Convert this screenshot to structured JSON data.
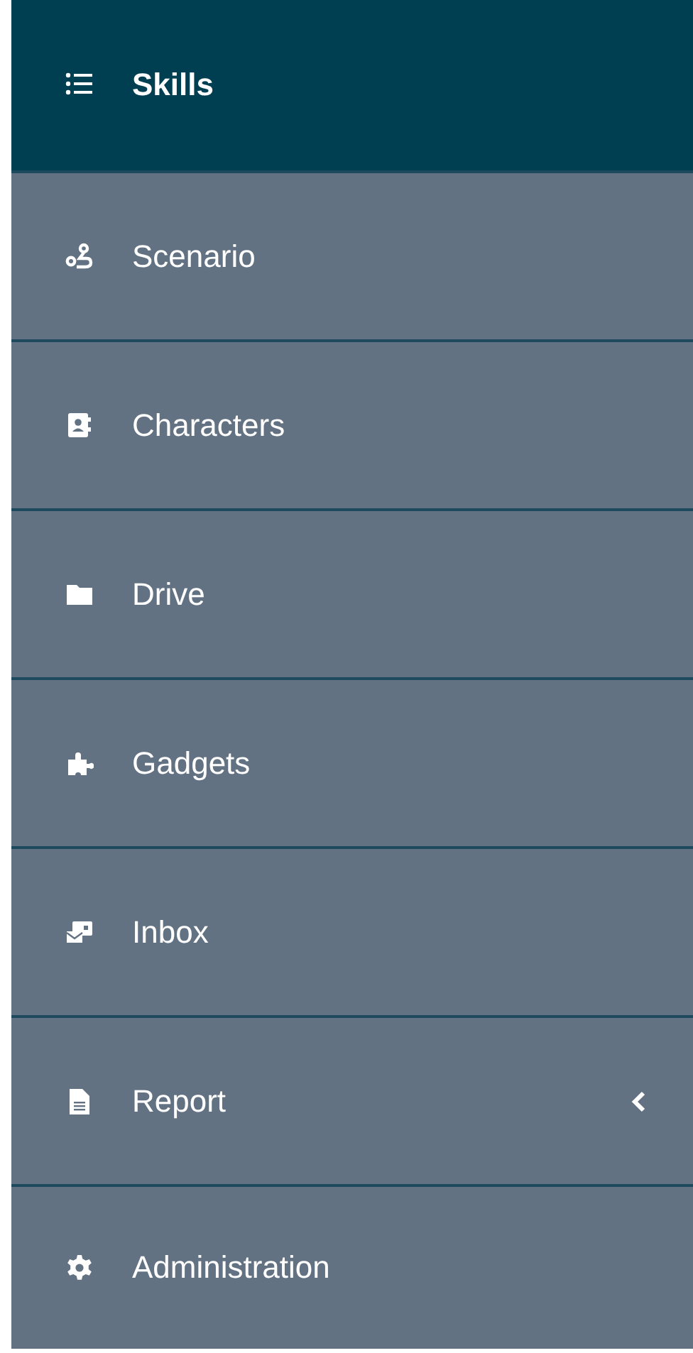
{
  "menu": {
    "items": [
      {
        "label": "Skills",
        "selected": true,
        "has_submenu": false
      },
      {
        "label": "Scenario",
        "selected": false,
        "has_submenu": false
      },
      {
        "label": "Characters",
        "selected": false,
        "has_submenu": false
      },
      {
        "label": "Drive",
        "selected": false,
        "has_submenu": false
      },
      {
        "label": "Gadgets",
        "selected": false,
        "has_submenu": false
      },
      {
        "label": "Inbox",
        "selected": false,
        "has_submenu": false
      },
      {
        "label": "Report",
        "selected": false,
        "has_submenu": true
      },
      {
        "label": "Administration",
        "selected": false,
        "has_submenu": false
      }
    ]
  }
}
